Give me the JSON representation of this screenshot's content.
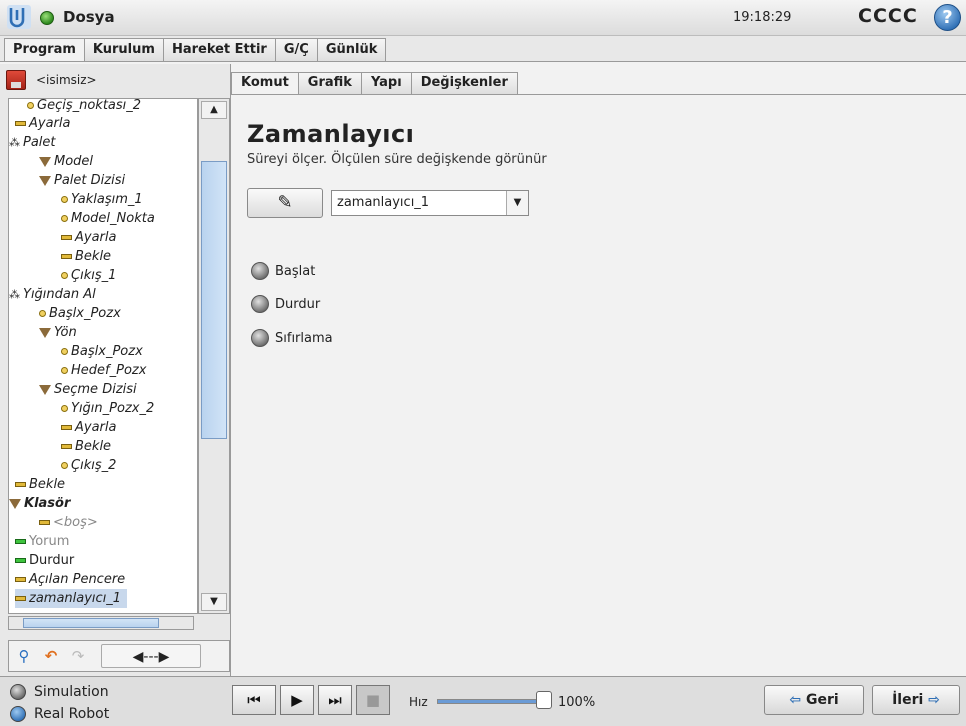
{
  "header": {
    "file_label": "Dosya",
    "time": "19:18:29",
    "robot_name": "CCCC",
    "help": "?"
  },
  "main_tabs": [
    "Program",
    "Kurulum",
    "Hareket Ettir",
    "G/Ç",
    "Günlük"
  ],
  "program": {
    "name": "<isimsiz>"
  },
  "tree": [
    "Geçiş_noktası_2",
    "Ayarla",
    "Palet",
    "Model",
    "Palet Dizisi",
    "Yaklaşım_1",
    "Model_Nokta",
    "Ayarla",
    "Bekle",
    "Çıkış_1",
    "Yığından Al",
    "Başlx_Pozx",
    "Yön",
    "Başlx_Pozx",
    "Hedef_Pozx",
    "Seçme Dizisi",
    "Yığın_Pozx_2",
    "Ayarla",
    "Bekle",
    "Çıkış_2",
    "Bekle",
    "Klasör",
    "<boş>",
    "Yorum",
    "Durdur",
    "Açılan Pencere",
    "zamanlayıcı_1"
  ],
  "sub_tabs": [
    "Komut",
    "Grafik",
    "Yapı",
    "Değişkenler"
  ],
  "content": {
    "title": "Zamanlayıcı",
    "subtitle": "Süreyi ölçer. Ölçülen süre değişkende görünür",
    "timer_value": "zamanlayıcı_1",
    "options": [
      "Başlat",
      "Durdur",
      "Sıfırlama"
    ]
  },
  "footer": {
    "simulation": "Simulation",
    "real_robot": "Real Robot",
    "speed_label": "Hız",
    "speed_value": "100%",
    "speed_fraction": 1.0,
    "back": "Geri",
    "next": "İleri"
  },
  "colors": {
    "accent_blue": "#2f6fb5",
    "status_green": "#2e8a1e"
  }
}
